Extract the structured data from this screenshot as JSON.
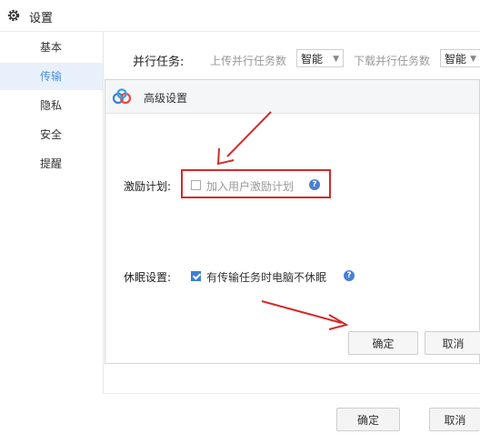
{
  "window": {
    "title": "设置",
    "icon": "gear-icon"
  },
  "sidebar": {
    "items": [
      {
        "label": "基本",
        "active": false
      },
      {
        "label": "传输",
        "active": true
      },
      {
        "label": "隐私",
        "active": false
      },
      {
        "label": "安全",
        "active": false
      },
      {
        "label": "提醒",
        "active": false
      }
    ]
  },
  "parallel": {
    "label": "并行任务:",
    "upload_label": "上传并行任务数",
    "upload_value": "智能",
    "download_label": "下载并行任务数",
    "download_value": "智能"
  },
  "dialog": {
    "title": "高级设置",
    "logo_icon": "cloud-logo-icon",
    "incentive": {
      "label": "激励计划:",
      "option": "加入用户激励计划",
      "checked": false
    },
    "sleep": {
      "label": "休眠设置:",
      "option": "有传输任务时电脑不休眠",
      "checked": true
    },
    "ok_label": "确定",
    "cancel_label": "取消"
  },
  "footer": {
    "ok_label": "确定",
    "cancel_label": "取消"
  },
  "colors": {
    "accent": "#3d7fd6",
    "annotation_red": "#d22b2b"
  }
}
